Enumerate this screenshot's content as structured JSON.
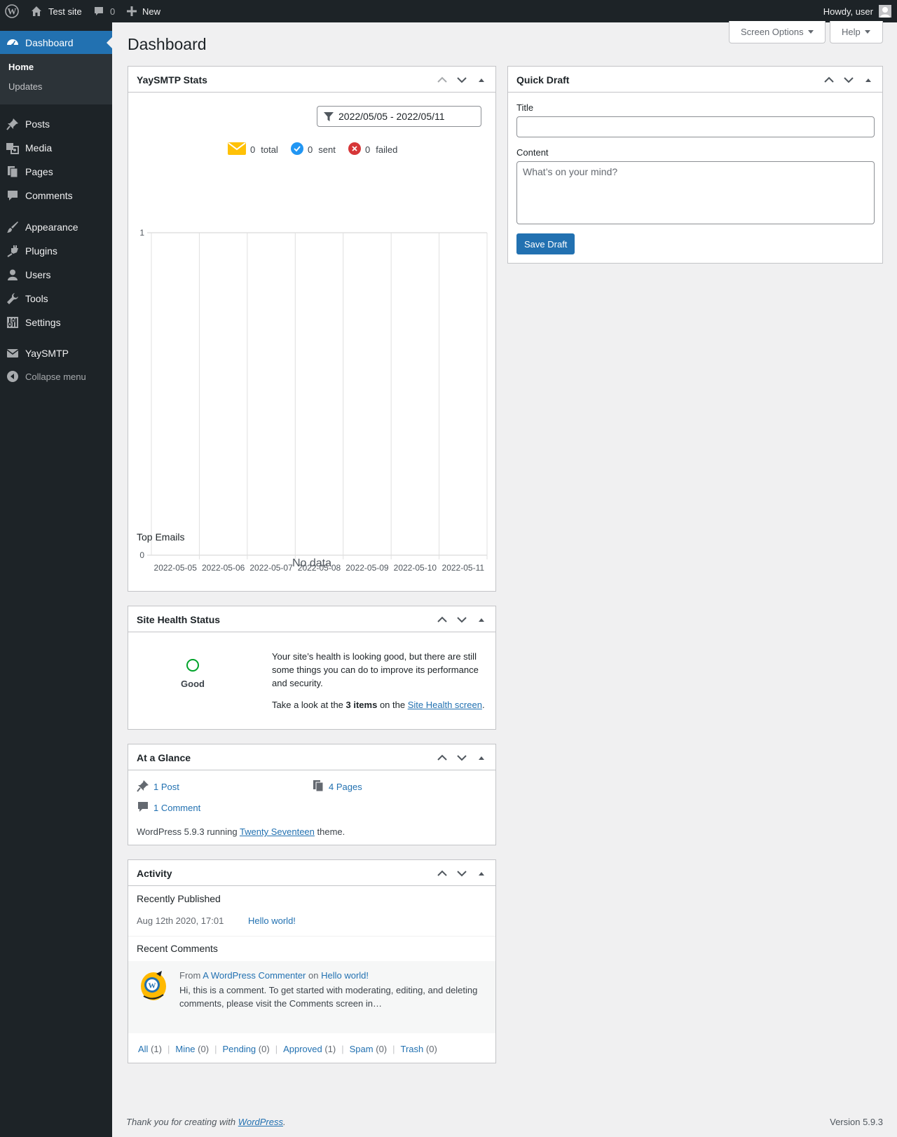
{
  "admin_bar": {
    "site_name": "Test site",
    "comments_count": "0",
    "new_label": "New",
    "howdy": "Howdy, user"
  },
  "sidebar": {
    "items": [
      {
        "label": "Dashboard",
        "icon": "dashboard-icon"
      },
      {
        "label": "Posts",
        "icon": "pin-icon"
      },
      {
        "label": "Media",
        "icon": "media-icon"
      },
      {
        "label": "Pages",
        "icon": "pages-icon"
      },
      {
        "label": "Comments",
        "icon": "comment-icon"
      },
      {
        "label": "Appearance",
        "icon": "brush-icon"
      },
      {
        "label": "Plugins",
        "icon": "plug-icon"
      },
      {
        "label": "Users",
        "icon": "user-icon"
      },
      {
        "label": "Tools",
        "icon": "wrench-icon"
      },
      {
        "label": "Settings",
        "icon": "settings-icon"
      },
      {
        "label": "YaySMTP",
        "icon": "envelope-icon"
      }
    ],
    "submenu": [
      "Home",
      "Updates"
    ],
    "collapse": "Collapse menu"
  },
  "header": {
    "title": "Dashboard",
    "screen_options": "Screen Options",
    "help": "Help"
  },
  "yaysmtp": {
    "title": "YaySMTP Stats",
    "date_range": "2022/05/05 - 2022/05/11",
    "stats": [
      {
        "value": "0",
        "label": "total"
      },
      {
        "value": "0",
        "label": "sent"
      },
      {
        "value": "0",
        "label": "failed"
      }
    ],
    "top_emails": "Top Emails",
    "no_data": "No data"
  },
  "chart_data": {
    "type": "line",
    "title": "",
    "xlabel": "",
    "ylabel": "",
    "x": [
      "2022-05-05",
      "2022-05-06",
      "2022-05-07",
      "2022-05-08",
      "2022-05-09",
      "2022-05-10",
      "2022-05-11"
    ],
    "y_ticks": [
      "1",
      "0"
    ],
    "ylim": [
      0,
      1
    ],
    "grid": true,
    "series": [
      {
        "values": [
          0,
          0,
          0,
          0,
          0,
          0,
          0
        ]
      }
    ]
  },
  "site_health": {
    "title": "Site Health Status",
    "status": "Good",
    "message": "Your site’s health is looking good, but there are still some things you can do to improve its performance and security.",
    "action_pre": "Take a look at the ",
    "action_bold": "3 items",
    "action_mid": " on the ",
    "action_link": "Site Health screen",
    "action_post": "."
  },
  "at_a_glance": {
    "title": "At a Glance",
    "posts": "1 Post",
    "pages": "4 Pages",
    "comments": "1 Comment",
    "version_pre": "WordPress 5.9.3 running ",
    "theme": "Twenty Seventeen",
    "version_post": " theme."
  },
  "activity": {
    "title": "Activity",
    "recently_published": "Recently Published",
    "post_date": "Aug 12th 2020, 17:01",
    "post_title": "Hello world!",
    "recent_comments": "Recent Comments",
    "comment_from": "From",
    "comment_author": "A WordPress Commenter",
    "comment_on": "on",
    "comment_post": "Hello world!",
    "comment_text": "Hi, this is a comment. To get started with moderating, editing, and deleting comments, please visit the Comments screen in…",
    "filters": [
      {
        "label": "All",
        "count": "(1)"
      },
      {
        "label": "Mine",
        "count": "(0)"
      },
      {
        "label": "Pending",
        "count": "(0)"
      },
      {
        "label": "Approved",
        "count": "(1)"
      },
      {
        "label": "Spam",
        "count": "(0)"
      },
      {
        "label": "Trash",
        "count": "(0)"
      }
    ]
  },
  "quick_draft": {
    "title": "Quick Draft",
    "title_label": "Title",
    "title_value": "",
    "content_label": "Content",
    "content_placeholder": "What’s on your mind?",
    "save_label": "Save Draft"
  },
  "footer": {
    "thanks_pre": "Thank you for creating with ",
    "wordpress": "WordPress",
    "thanks_post": ".",
    "version": "Version 5.9.3"
  },
  "colors": {
    "accent": "#2271b1",
    "sidebar_bg": "#1d2327",
    "good": "#00a32a",
    "failed": "#d63638",
    "sent": "#2196f3",
    "total": "#ffc107"
  }
}
